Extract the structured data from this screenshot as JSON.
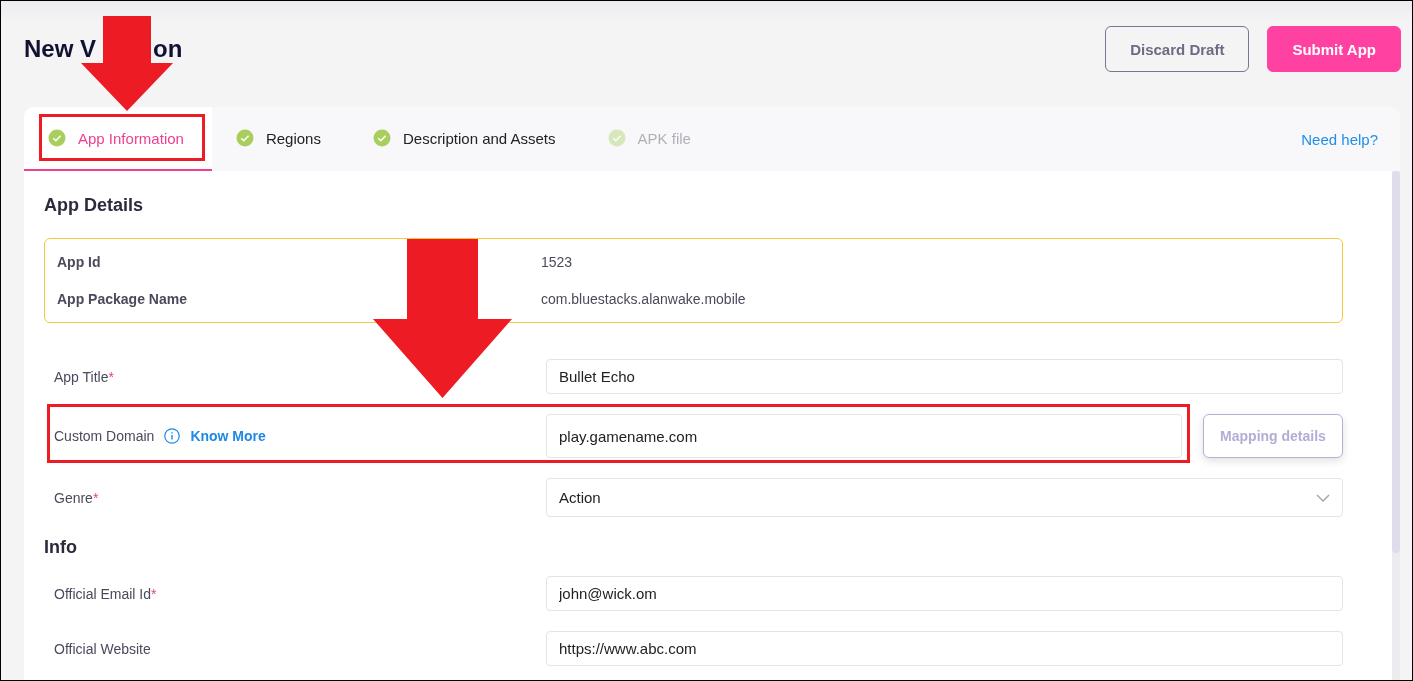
{
  "page": {
    "title": [
      "New V",
      "on"
    ]
  },
  "actions": [
    {
      "label": "Discard Draft",
      "kind": "secondary"
    },
    {
      "label": "Submit App",
      "kind": "primary"
    }
  ],
  "tabs": [
    {
      "label": "App Information",
      "selected": true,
      "disabled": false
    },
    {
      "label": "Regions",
      "selected": false,
      "disabled": false
    },
    {
      "label": "Description and Assets",
      "selected": false,
      "disabled": false
    },
    {
      "label": "APK file",
      "selected": false,
      "disabled": true
    }
  ],
  "help_link": "Need help?",
  "sections": [
    {
      "title": "App Details",
      "summary": [
        {
          "label": "App Id",
          "value": "1523"
        },
        {
          "label": "App Package Name",
          "value": "com.bluestacks.alanwake.mobile"
        }
      ],
      "fields": [
        {
          "label": "App Title",
          "required_mark": "*",
          "kind": "text",
          "value": "Bullet Echo"
        },
        {
          "label": "Custom Domain",
          "kind": "text",
          "info_link": "Know More",
          "value": "play.gamename.com",
          "button": {
            "label": "Mapping details",
            "disabled": true
          }
        },
        {
          "label": "Genre",
          "required_mark": "*",
          "kind": "select",
          "value": "Action"
        }
      ]
    },
    {
      "title": "Info",
      "fields": [
        {
          "label": "Official Email Id",
          "required_mark": "*",
          "kind": "text",
          "value": "john@wick.om"
        },
        {
          "label": "Official Website",
          "kind": "text",
          "value": "https://www.abc.com"
        }
      ]
    }
  ]
}
